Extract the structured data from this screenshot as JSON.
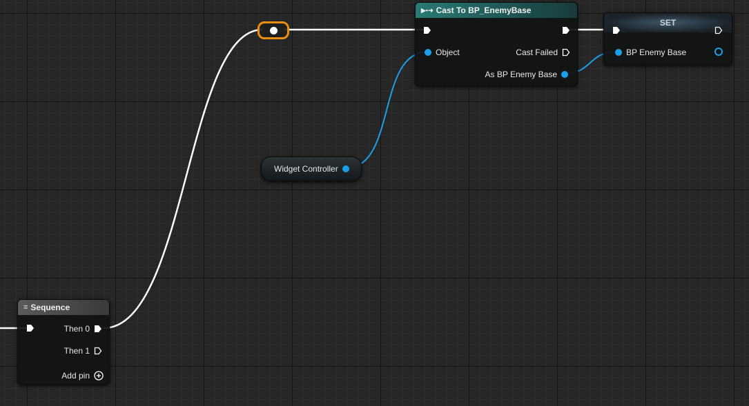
{
  "sequence": {
    "title": "Sequence",
    "then0": "Then 0",
    "then1": "Then 1",
    "add_pin": "Add pin"
  },
  "cast": {
    "title": "Cast To BP_EnemyBase",
    "object": "Object",
    "cast_failed": "Cast Failed",
    "as_bp": "As BP Enemy Base"
  },
  "set": {
    "title": "SET",
    "var": "BP Enemy Base"
  },
  "widget": {
    "label": "Widget Controller"
  },
  "colors": {
    "exec": "#ffffff",
    "object_pin": "#1aa0e8",
    "reroute_highlight": "#e8900c",
    "cast_header": "#1f5f5c",
    "set_header": "#2a3a44"
  }
}
